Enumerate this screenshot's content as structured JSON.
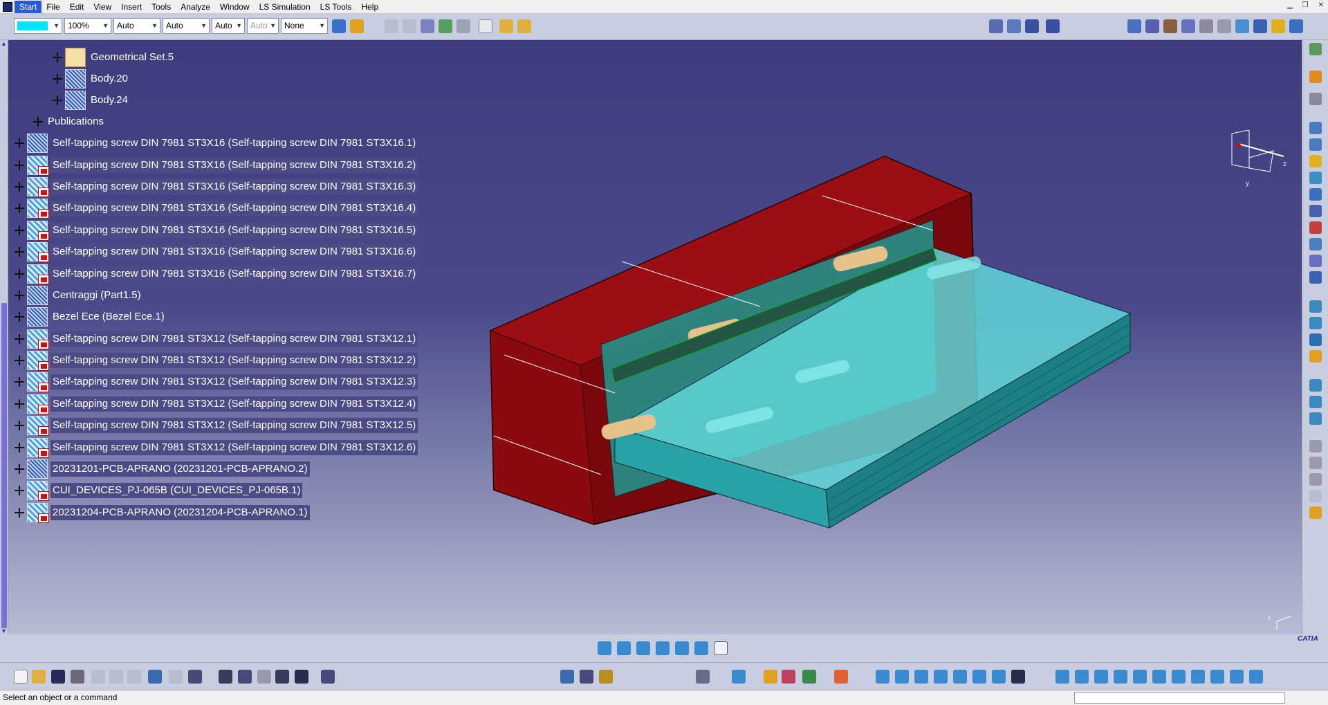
{
  "menubar": {
    "items": [
      "Start",
      "File",
      "Edit",
      "View",
      "Insert",
      "Tools",
      "Analyze",
      "Window",
      "LS Simulation",
      "LS Tools",
      "Help"
    ]
  },
  "toolbar": {
    "color_value": "",
    "zoom": "100%",
    "combo_a": "Auto",
    "combo_b": "Auto",
    "combo_c": "Auto",
    "combo_d": "Auto",
    "none_value": "None"
  },
  "tree": {
    "items": [
      {
        "label": "Geometrical Set.5",
        "icon": "geometrical-set-icon"
      },
      {
        "label": "Body.20",
        "icon": "body-icon"
      },
      {
        "label": "Body.24",
        "icon": "body-icon"
      },
      {
        "label": "Publications",
        "icon": "publications-icon"
      },
      {
        "label": "Self-tapping screw DIN 7981 ST3X16 (Self-tapping screw DIN 7981 ST3X16.1)",
        "icon": "part-icon",
        "selected": false
      },
      {
        "label": "Self-tapping screw DIN 7981 ST3X16 (Self-tapping screw DIN 7981 ST3X16.2)",
        "icon": "product-icon",
        "selected": true
      },
      {
        "label": "Self-tapping screw DIN 7981 ST3X16 (Self-tapping screw DIN 7981 ST3X16.3)",
        "icon": "product-icon",
        "selected": true
      },
      {
        "label": "Self-tapping screw DIN 7981 ST3X16 (Self-tapping screw DIN 7981 ST3X16.4)",
        "icon": "product-icon",
        "selected": true
      },
      {
        "label": "Self-tapping screw DIN 7981 ST3X16 (Self-tapping screw DIN 7981 ST3X16.5)",
        "icon": "product-icon",
        "selected": true
      },
      {
        "label": "Self-tapping screw DIN 7981 ST3X16 (Self-tapping screw DIN 7981 ST3X16.6)",
        "icon": "product-icon",
        "selected": true
      },
      {
        "label": "Self-tapping screw DIN 7981 ST3X16 (Self-tapping screw DIN 7981 ST3X16.7)",
        "icon": "product-icon",
        "selected": true
      },
      {
        "label": "Centraggi (Part1.5)",
        "icon": "part-icon",
        "selected": false
      },
      {
        "label": "Bezel Ece (Bezel Ece.1)",
        "icon": "part-icon",
        "selected": false
      },
      {
        "label": "Self-tapping screw DIN 7981 ST3X12 (Self-tapping screw DIN 7981 ST3X12.1)",
        "icon": "product-icon",
        "selected": true
      },
      {
        "label": "Self-tapping screw DIN 7981 ST3X12 (Self-tapping screw DIN 7981 ST3X12.2)",
        "icon": "product-icon",
        "selected": true
      },
      {
        "label": "Self-tapping screw DIN 7981 ST3X12 (Self-tapping screw DIN 7981 ST3X12.3)",
        "icon": "product-icon",
        "selected": true
      },
      {
        "label": "Self-tapping screw DIN 7981 ST3X12 (Self-tapping screw DIN 7981 ST3X12.4)",
        "icon": "product-icon",
        "selected": true
      },
      {
        "label": "Self-tapping screw DIN 7981 ST3X12 (Self-tapping screw DIN 7981 ST3X12.5)",
        "icon": "product-icon",
        "selected": true
      },
      {
        "label": "Self-tapping screw DIN 7981 ST3X12 (Self-tapping screw DIN 7981 ST3X12.6)",
        "icon": "product-icon",
        "selected": true
      },
      {
        "label": "20231201-PCB-APRANO (20231201-PCB-APRANO.2)",
        "icon": "part-icon",
        "selected": true
      },
      {
        "label": "CUI_DEVICES_PJ-065B (CUI_DEVICES_PJ-065B.1)",
        "icon": "product-icon",
        "selected": true
      },
      {
        "label": "20231204-PCB-APRANO (20231204-PCB-APRANO.1)",
        "icon": "product-icon",
        "selected": true
      }
    ]
  },
  "compass": {
    "x": "x",
    "y": "y",
    "z": "z"
  },
  "status": {
    "text": "Select an object or a command"
  },
  "brand": {
    "name": "CATIA"
  },
  "colors": {
    "background_top": "#3e3c7e",
    "housing": "#8e0a10",
    "pcb": "#3fc0c8",
    "selection": "#4d4b85"
  }
}
